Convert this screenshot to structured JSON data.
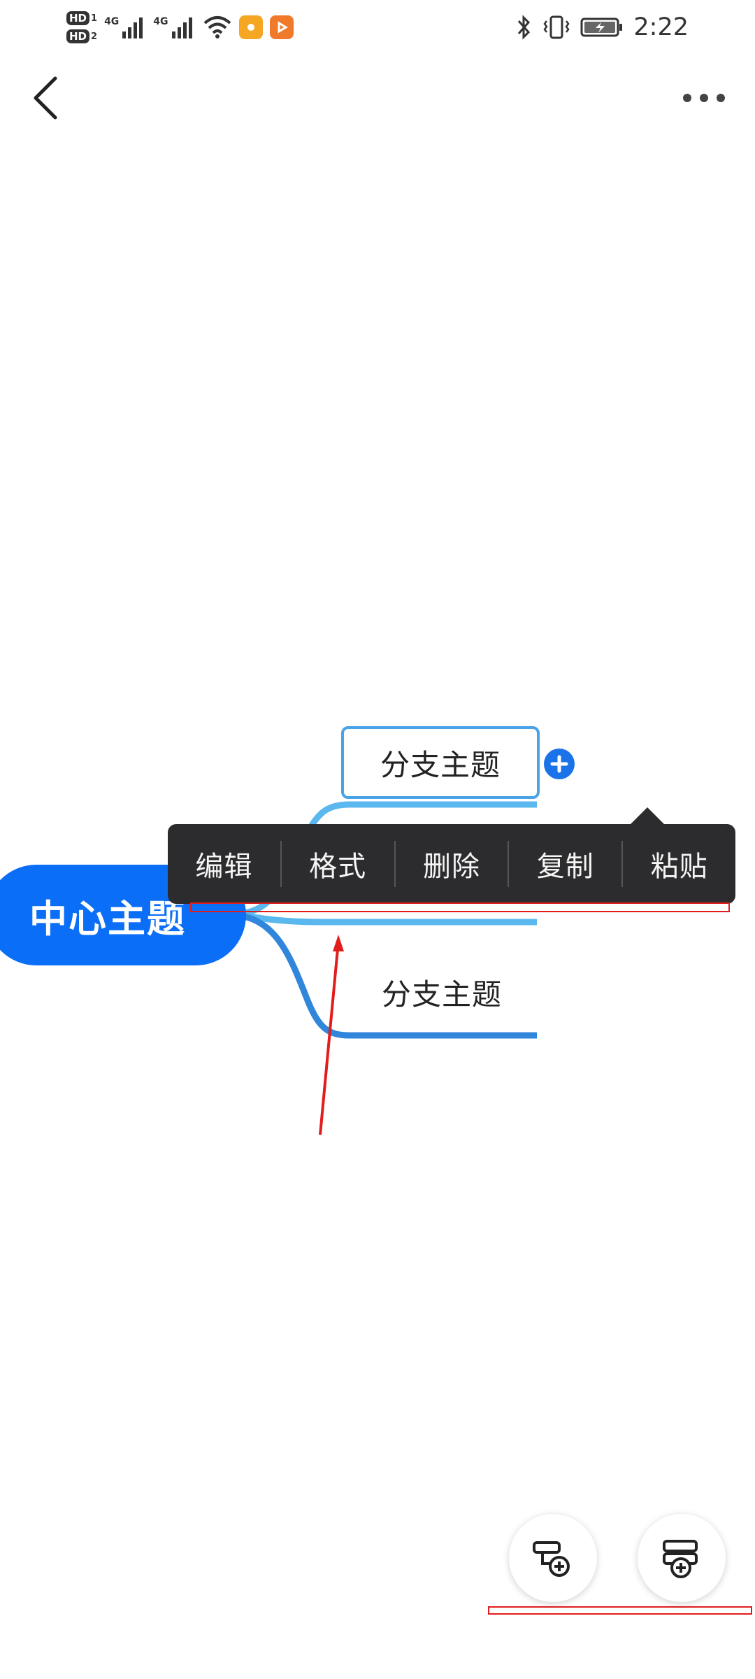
{
  "status_bar": {
    "hd1": "HD",
    "hd1_num": "1",
    "hd2": "HD",
    "hd2_num": "2",
    "network1": "4G",
    "network2": "4G",
    "time": "2:22",
    "icons": [
      "signal-icon",
      "signal-icon",
      "wifi-icon",
      "app-notification-icon",
      "video-app-icon",
      "bluetooth-icon",
      "vibrate-icon",
      "battery-charging-icon"
    ]
  },
  "nav": {
    "back_icon": "chevron-left-icon",
    "more_icon": "more-horizontal-icon"
  },
  "mindmap": {
    "root_label": "中心主题",
    "branch_top_label": "分支主题",
    "branch_bottom_label": "分支主题",
    "add_icon": "plus-circle-icon"
  },
  "context_menu": {
    "items": [
      "编辑",
      "格式",
      "删除",
      "复制",
      "粘贴"
    ]
  },
  "fabs": {
    "add_child_icon": "add-subtopic-icon",
    "add_sibling_icon": "add-topic-icon"
  },
  "colors": {
    "root": "#0a6ef6",
    "branch_line_top": "#5ab8ee",
    "branch_line_bottom": "#2f86da",
    "menu_bg": "#2c2c2e",
    "annotation": "#e21d1d"
  }
}
